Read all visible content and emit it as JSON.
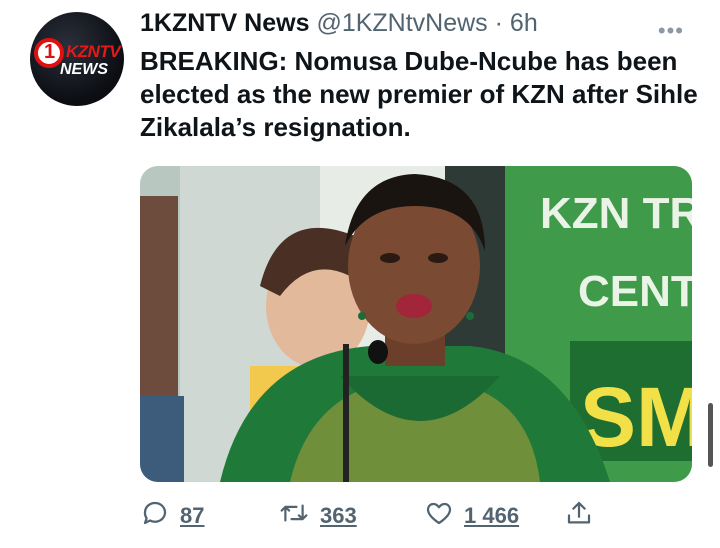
{
  "tweet": {
    "display_name": "1KZNTV News",
    "handle": "@1KZNtvNews",
    "separator": "·",
    "time": "6h",
    "text": "BREAKING: Nomusa Dube-Ncube has been elected as the new premier of KZN after Sihle Zikalala’s resignation.",
    "more_icon": "more-icon"
  },
  "avatar": {
    "logo_text_1": "1",
    "logo_text_2": "KZNTV",
    "logo_text_3": "NEWS"
  },
  "media": {
    "banner_line_1": "KZN TR",
    "banner_line_2": "CENT",
    "banner_line_3": "SM",
    "colors": {
      "banner": "#3f9a4a",
      "dress_green": "#1f7a3a"
    }
  },
  "actions": {
    "reply_count": "87",
    "retweet_count": "363",
    "like_count": "1 466",
    "icons": [
      "reply-icon",
      "retweet-icon",
      "like-icon",
      "share-icon"
    ]
  }
}
